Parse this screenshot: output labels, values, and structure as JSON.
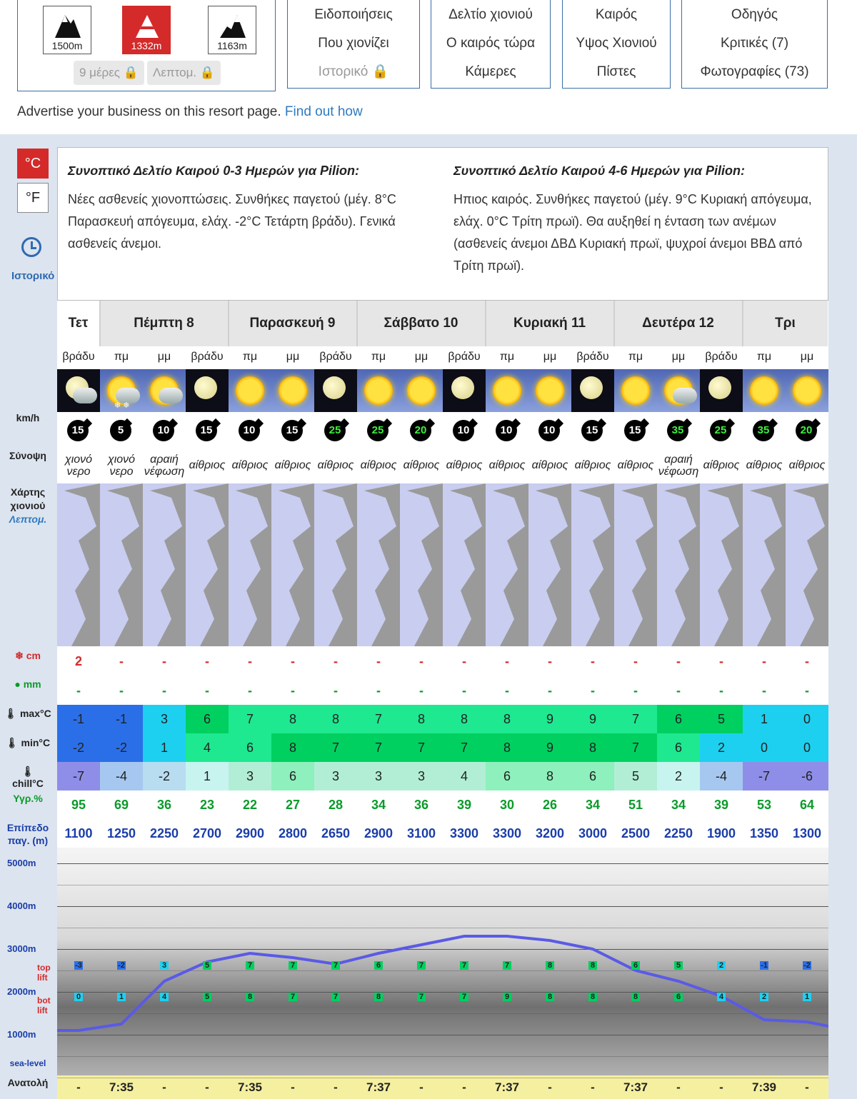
{
  "peaks": [
    {
      "label": "1500m",
      "selected": false
    },
    {
      "label": "1332m",
      "selected": true
    },
    {
      "label": "1163m",
      "selected": false
    }
  ],
  "locked_buttons": [
    "9 μέρες",
    "Λεπτομ."
  ],
  "menus": [
    [
      "Ειδοποιήσεις",
      "Που χιονίζει",
      "Ιστορικό"
    ],
    [
      "Δελτίο χιονιού",
      "Ο καιρός τώρα",
      "Κάμερες"
    ],
    [
      "Καιρός",
      "Υψος Χιονιού",
      "Πίστες"
    ],
    [
      "Οδηγός",
      "Κριτικές (7)",
      "Φωτογραφίες (73)"
    ]
  ],
  "advert": {
    "text": "Advertise your business on this resort page.",
    "link": "Find out how"
  },
  "units": {
    "c": "°C",
    "f": "°F"
  },
  "history_label": "Ιστορικό",
  "summary": {
    "left_title": "Συνοπτικό Δελτίο Καιρού 0-3 Ημερών για Pilion:",
    "left_text": "Νέες ασθενείς χιονοπτώσεις. Συνθήκες παγετού (μέγ. 8°C Παρασκευή απόγευμα, ελάχ. -2°C Τετάρτη βράδυ). Γενικά ασθενείς άνεμοι.",
    "right_title": "Συνοπτικό Δελτίο Καιρού 4-6 Ημερών για Pilion:",
    "right_text": "Ηπιος καιρός. Συνθήκες παγετού (μέγ. 9°C Κυριακή απόγευμα, ελάχ. 0°C Τρίτη πρωϊ). Θα αυξηθεί η ένταση των ανέμων (ασθενείς άνεμοι ΔΒΔ Κυριακή πρωϊ, ψυχροί άνεμοι ΒΒΔ από Τρίτη πρωϊ)."
  },
  "row_labels": {
    "wind": "km/h",
    "summary": "Σύνοψη",
    "map1": "Χάρτης",
    "map2": "χιονιού",
    "map3": "Λεπτομ.",
    "snow": "cm",
    "rain": "mm",
    "max": "max°C",
    "min": "min°C",
    "chill": "chill°C",
    "hum": "Υγρ.%",
    "fl1": "Επίπεδο",
    "fl2": "παγ. (m)",
    "sealevel": "sea-level",
    "sunrise": "Ανατολή",
    "top_lift": "top lift",
    "bot_lift": "bot lift"
  },
  "days": [
    {
      "name": "Τετ",
      "span": 1
    },
    {
      "name": "Πέμπτη 8",
      "span": 3
    },
    {
      "name": "Παρασκευή 9",
      "span": 3
    },
    {
      "name": "Σάββατο 10",
      "span": 3
    },
    {
      "name": "Κυριακή 11",
      "span": 3
    },
    {
      "name": "Δευτέρα 12",
      "span": 3
    },
    {
      "name": "Τρι",
      "span": 2
    }
  ],
  "periods": [
    "βράδυ",
    "πμ",
    "μμ",
    "βράδυ",
    "πμ",
    "μμ",
    "βράδυ",
    "πμ",
    "μμ",
    "βράδυ",
    "πμ",
    "μμ",
    "βράδυ",
    "πμ",
    "μμ",
    "βράδυ",
    "πμ",
    "μμ"
  ],
  "icons": [
    "moon-cloud-night",
    "sun-cloud-snow",
    "sun-cloud",
    "moon",
    "sun",
    "sun",
    "moon",
    "sun",
    "sun",
    "moon",
    "sun",
    "sun",
    "moon",
    "sun",
    "sun-cloud",
    "moon",
    "sun",
    "sun"
  ],
  "wind": [
    15,
    5,
    10,
    15,
    10,
    15,
    25,
    25,
    20,
    10,
    10,
    10,
    15,
    15,
    35,
    25,
    35,
    20
  ],
  "summaries": [
    "χιονό νερο",
    "χιονό νερο",
    "αραιή νέφωση",
    "αίθριος",
    "αίθριος",
    "αίθριος",
    "αίθριος",
    "αίθριος",
    "αίθριος",
    "αίθριος",
    "αίθριος",
    "αίθριος",
    "αίθριος",
    "αίθριος",
    "αραιή νέφωση",
    "αίθριος",
    "αίθριος",
    "αίθριος"
  ],
  "snow": [
    "2",
    "-",
    "-",
    "-",
    "-",
    "-",
    "-",
    "-",
    "-",
    "-",
    "-",
    "-",
    "-",
    "-",
    "-",
    "-",
    "-",
    "-"
  ],
  "rain": [
    "-",
    "-",
    "-",
    "-",
    "-",
    "-",
    "-",
    "-",
    "-",
    "-",
    "-",
    "-",
    "-",
    "-",
    "-",
    "-",
    "-",
    "-"
  ],
  "tmax": [
    -1,
    -1,
    3,
    6,
    7,
    8,
    8,
    7,
    8,
    8,
    8,
    9,
    9,
    7,
    6,
    5,
    1,
    0
  ],
  "tmin": [
    -2,
    -2,
    1,
    4,
    6,
    8,
    7,
    7,
    7,
    7,
    8,
    9,
    8,
    7,
    6,
    2,
    0,
    0
  ],
  "chill": [
    -7,
    -4,
    -2,
    1,
    3,
    6,
    3,
    3,
    3,
    4,
    6,
    8,
    6,
    5,
    2,
    -4,
    -7,
    -6
  ],
  "humidity": [
    95,
    69,
    36,
    23,
    22,
    27,
    28,
    34,
    36,
    39,
    30,
    26,
    34,
    51,
    34,
    39,
    53,
    64
  ],
  "freezing": [
    1100,
    1250,
    2250,
    2700,
    2900,
    2800,
    2650,
    2900,
    3100,
    3300,
    3300,
    3200,
    3000,
    2500,
    2250,
    1900,
    1350,
    1300
  ],
  "top_lift": [
    -3,
    -2,
    3,
    5,
    7,
    7,
    7,
    6,
    7,
    7,
    7,
    8,
    8,
    6,
    5,
    2,
    -1,
    -2
  ],
  "bot_lift": [
    0,
    1,
    4,
    5,
    8,
    7,
    7,
    8,
    7,
    7,
    9,
    8,
    8,
    8,
    6,
    4,
    2,
    1
  ],
  "altitude_labels": [
    "5000m",
    "4000m",
    "3000m",
    "2000m",
    "1000m"
  ],
  "sunrise": [
    "-",
    "7:35",
    "-",
    "-",
    "7:35",
    "-",
    "-",
    "7:37",
    "-",
    "-",
    "7:37",
    "-",
    "-",
    "7:37",
    "-",
    "-",
    "7:39",
    "-"
  ],
  "colors": {
    "accent": "#d42a2a",
    "link": "#2f7abf",
    "line": "#5a5ae6"
  }
}
